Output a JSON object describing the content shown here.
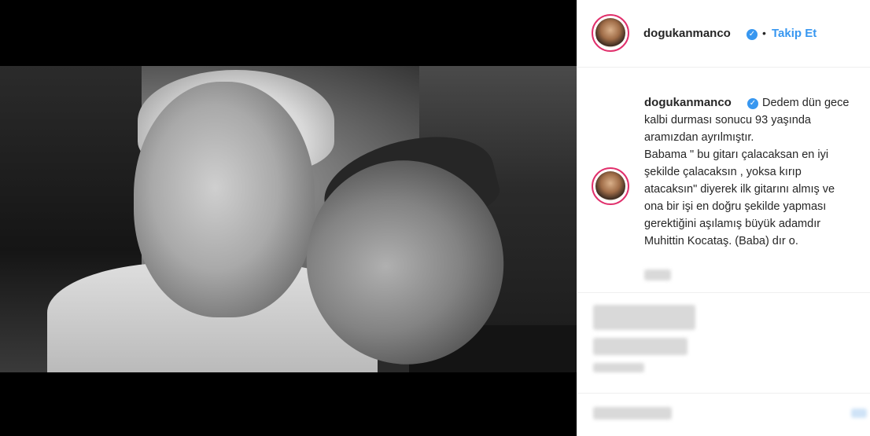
{
  "post": {
    "username": "dogukanmanco",
    "verified_icon": "verified-badge-icon",
    "separator": "•",
    "follow_label": "Takip Et",
    "caption_lines": [
      "Dedem dün gece",
      "kalbi durması sonucu 93 yaşında",
      "aramızdan ayrılmıştır.",
      "Babama \" bu gitarı çalacaksan en iyi",
      "şekilde çalacaksın , yoksa kırıp",
      "atacaksın\" diyerek ilk gitarını almış ve",
      "ona bir işi en doğru şekilde yapması",
      "gerektiğini aşılamış büyük adamdır",
      "Muhittin Kocataş. (Baba) dır o."
    ]
  },
  "colors": {
    "accent": "#3897f0",
    "text": "#262626",
    "border": "#efefef"
  }
}
